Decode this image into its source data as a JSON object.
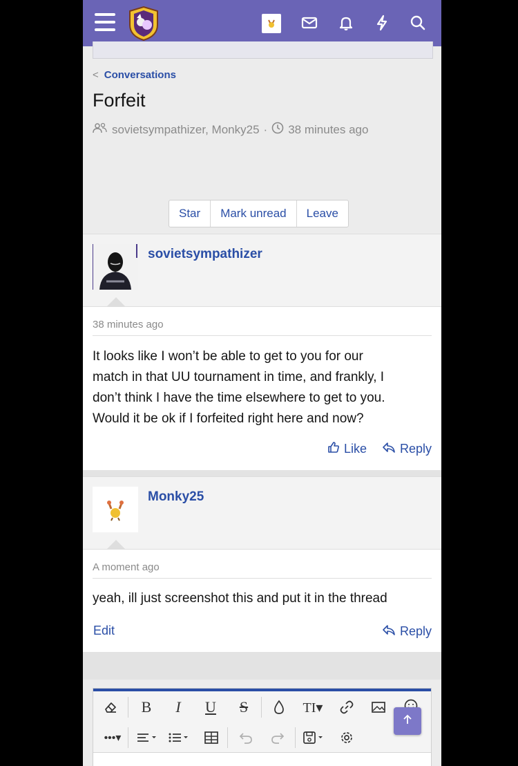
{
  "colors": {
    "header": "#6a64b6",
    "link": "#2a4ea6",
    "muted": "#8a8a8a"
  },
  "header": {
    "icons": [
      "menu-icon",
      "forum-logo",
      "user-avatar",
      "inbox-icon",
      "bell-icon",
      "bolt-icon",
      "search-icon"
    ]
  },
  "breadcrumb": {
    "label": "Conversations"
  },
  "conversation": {
    "title": "Forfeit",
    "participants": "sovietsympathizer, Monky25",
    "separator": "·",
    "time": "38 minutes ago"
  },
  "actions": {
    "star": "Star",
    "mark_unread": "Mark unread",
    "leave": "Leave"
  },
  "messages": [
    {
      "user": "sovietsympathizer",
      "time": "38 minutes ago",
      "lines": [
        "It looks like I won’t be able to get to you for our",
        "match in that UU tournament in time, and frankly, I",
        "don’t think I have the time elsewhere to get to you.",
        "Would it be ok if I forfeited right here and now?"
      ],
      "like": "Like",
      "reply": "Reply"
    },
    {
      "user": "Monky25",
      "time": "A moment ago",
      "text": "yeah, ill just screenshot this and put it in the thread",
      "edit": "Edit",
      "reply": "Reply"
    }
  ],
  "editor": {
    "toolbar_icons": [
      "eraser-icon",
      "bold-icon",
      "italic-icon",
      "underline-icon",
      "strikethrough-icon",
      "color-icon",
      "text-size-icon",
      "link-icon",
      "image-icon",
      "emoji-icon",
      "more-icon",
      "align-icon",
      "list-icon",
      "table-icon",
      "undo-icon",
      "redo-icon",
      "save-draft-icon",
      "settings-icon"
    ]
  }
}
